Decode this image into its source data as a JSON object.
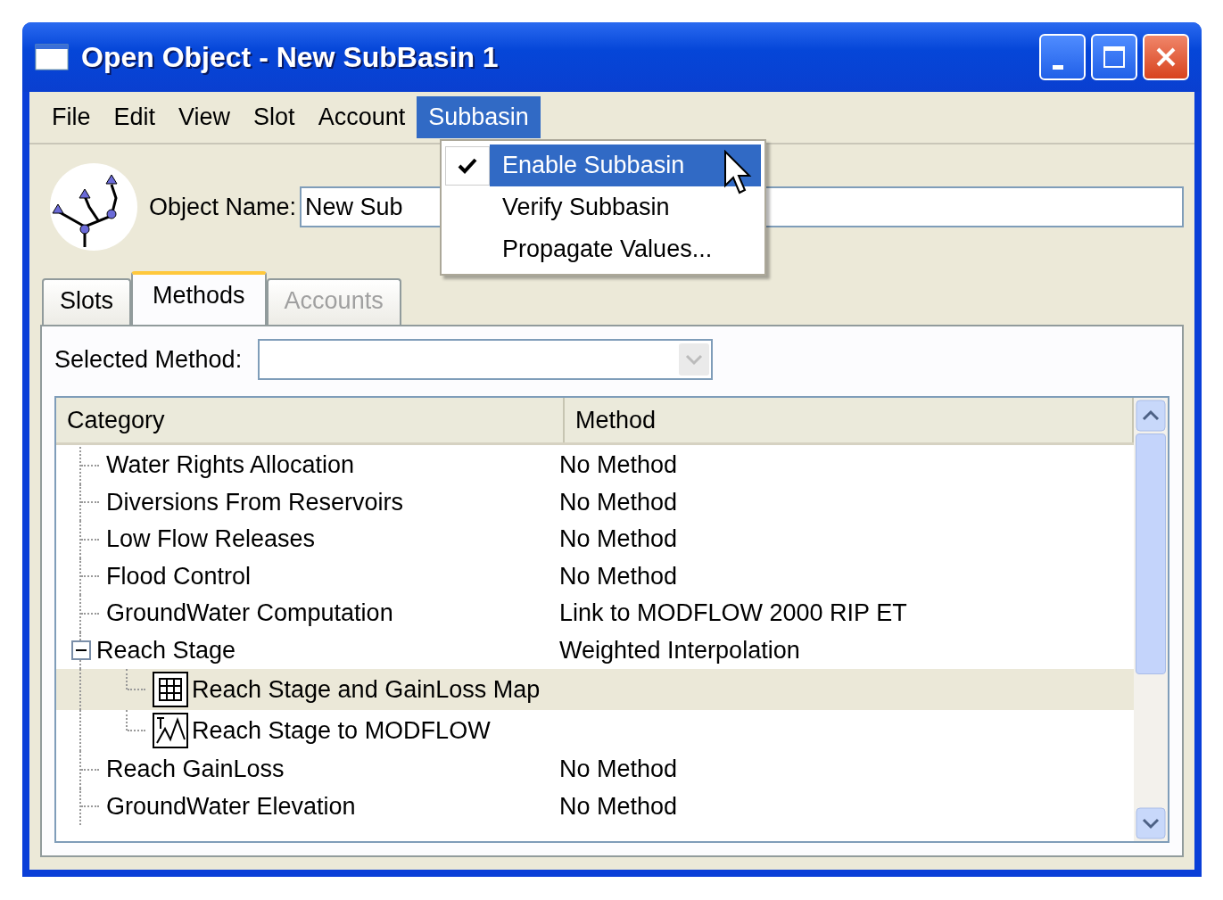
{
  "window": {
    "title": "Open Object - New SubBasin 1"
  },
  "menu_bar": [
    {
      "label": "File",
      "selected": false
    },
    {
      "label": "Edit",
      "selected": false
    },
    {
      "label": "View",
      "selected": false
    },
    {
      "label": "Slot",
      "selected": false
    },
    {
      "label": "Account",
      "selected": false
    },
    {
      "label": "Subbasin",
      "selected": true
    }
  ],
  "dropdown_menu": [
    {
      "label": "Enable Subbasin",
      "checked": true,
      "selected": true
    },
    {
      "label": "Verify Subbasin",
      "checked": false,
      "selected": false
    },
    {
      "label": "Propagate Values...",
      "checked": false,
      "selected": false
    }
  ],
  "object_name": {
    "label": "Object Name:",
    "value": "New Sub"
  },
  "tabs": [
    {
      "label": "Slots",
      "selected": false,
      "disabled": false
    },
    {
      "label": "Methods",
      "selected": true,
      "disabled": false
    },
    {
      "label": "Accounts",
      "selected": false,
      "disabled": true
    }
  ],
  "selected_method": {
    "label": "Selected Method:"
  },
  "tree": {
    "columns": [
      "Category",
      "Method"
    ],
    "rows": [
      {
        "category": "Water Rights Allocation",
        "method": "No Method",
        "selected": false
      },
      {
        "category": "Diversions From Reservoirs",
        "method": "No Method",
        "selected": false
      },
      {
        "category": "Low Flow Releases",
        "method": "No Method",
        "selected": false
      },
      {
        "category": "Flood Control",
        "method": "No Method",
        "selected": false
      },
      {
        "category": "GroundWater Computation",
        "method": "Link to MODFLOW 2000 RIP ET",
        "selected": false
      },
      {
        "category": "Reach Stage",
        "method": "Weighted Interpolation",
        "selected": false,
        "expanded": true,
        "children": [
          {
            "category": "Reach Stage and GainLoss Map",
            "kind": "table",
            "selected": true
          },
          {
            "category": "Reach Stage to MODFLOW",
            "kind": "graph",
            "selected": false
          }
        ]
      },
      {
        "category": "Reach GainLoss",
        "method": "No Method",
        "selected": false
      },
      {
        "category": "GroundWater Elevation",
        "method": "No Method",
        "selected": false
      }
    ]
  }
}
